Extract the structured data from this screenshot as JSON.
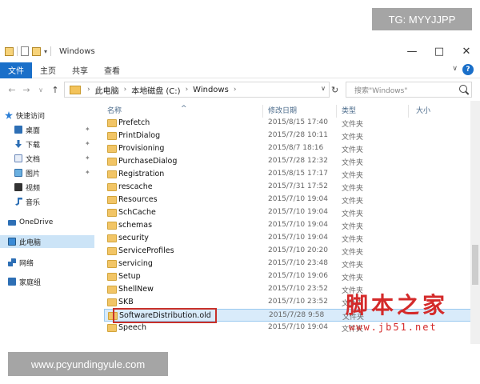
{
  "window": {
    "title": "Windows",
    "controls": {
      "minimize": "—",
      "maximize": "□",
      "close": "✕"
    }
  },
  "ribbon": {
    "tabs": [
      {
        "label": "文件"
      },
      {
        "label": "主页"
      },
      {
        "label": "共享"
      },
      {
        "label": "查看"
      }
    ],
    "help": "?"
  },
  "address": {
    "crumbs": [
      "此电脑",
      "本地磁盘 (C:)",
      "Windows"
    ],
    "search_placeholder": "搜索\"Windows\""
  },
  "nav": {
    "items": [
      {
        "label": "快速访问",
        "icon": "star-icon"
      },
      {
        "label": "桌面",
        "icon": "desktop-icon",
        "pinned": true
      },
      {
        "label": "下载",
        "icon": "download-icon",
        "pinned": true
      },
      {
        "label": "文档",
        "icon": "document-icon",
        "pinned": true
      },
      {
        "label": "图片",
        "icon": "picture-icon",
        "pinned": true
      },
      {
        "label": "视频",
        "icon": "video-icon"
      },
      {
        "label": "音乐",
        "icon": "music-icon"
      },
      {
        "label": "OneDrive",
        "icon": "cloud-icon"
      },
      {
        "label": "此电脑",
        "icon": "pc-icon",
        "selected": true
      },
      {
        "label": "网络",
        "icon": "network-icon"
      },
      {
        "label": "家庭组",
        "icon": "homegroup-icon"
      }
    ]
  },
  "columns": {
    "name": "名称",
    "date": "修改日期",
    "type": "类型",
    "size": "大小"
  },
  "files": [
    {
      "name": "Prefetch",
      "date": "2015/8/15 17:40",
      "type": "文件夹"
    },
    {
      "name": "PrintDialog",
      "date": "2015/7/28 10:11",
      "type": "文件夹"
    },
    {
      "name": "Provisioning",
      "date": "2015/8/7 18:16",
      "type": "文件夹"
    },
    {
      "name": "PurchaseDialog",
      "date": "2015/7/28 12:32",
      "type": "文件夹"
    },
    {
      "name": "Registration",
      "date": "2015/8/15 17:17",
      "type": "文件夹"
    },
    {
      "name": "rescache",
      "date": "2015/7/31 17:52",
      "type": "文件夹"
    },
    {
      "name": "Resources",
      "date": "2015/7/10 19:04",
      "type": "文件夹"
    },
    {
      "name": "SchCache",
      "date": "2015/7/10 19:04",
      "type": "文件夹"
    },
    {
      "name": "schemas",
      "date": "2015/7/10 19:04",
      "type": "文件夹"
    },
    {
      "name": "security",
      "date": "2015/7/10 19:04",
      "type": "文件夹"
    },
    {
      "name": "ServiceProfiles",
      "date": "2015/7/10 20:20",
      "type": "文件夹"
    },
    {
      "name": "servicing",
      "date": "2015/7/10 23:48",
      "type": "文件夹"
    },
    {
      "name": "Setup",
      "date": "2015/7/10 19:06",
      "type": "文件夹"
    },
    {
      "name": "ShellNew",
      "date": "2015/7/10 23:52",
      "type": "文件夹"
    },
    {
      "name": "SKB",
      "date": "2015/7/10 23:52",
      "type": "文件夹"
    },
    {
      "name": "SoftwareDistribution.old",
      "date": "2015/7/28 9:58",
      "type": "文件夹",
      "selected": true
    },
    {
      "name": "Speech",
      "date": "2015/7/10 19:04",
      "type": "文件夹"
    }
  ],
  "overlays": {
    "tg": "TG: MYYJJPP",
    "site": "www.pcyundingyule.com",
    "watermark_cn": "脚本之家",
    "watermark_url": "www.jb51.net"
  },
  "colors": {
    "accent": "#1a6fc9",
    "highlight": "#c8302a",
    "folder": "#f2c566"
  }
}
